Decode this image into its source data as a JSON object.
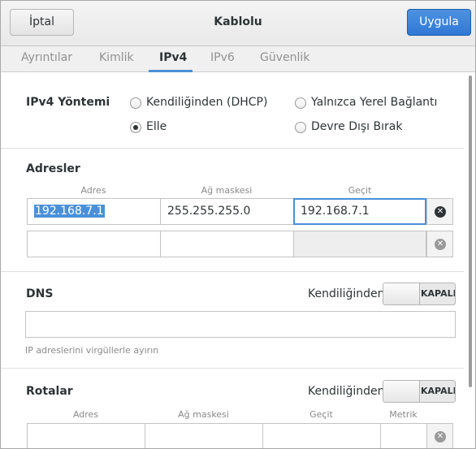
{
  "header": {
    "cancel_label": "İptal",
    "title": "Kablolu",
    "apply_label": "Uygula"
  },
  "tabs": [
    {
      "label": "Ayrıntılar",
      "active": false
    },
    {
      "label": "Kimlik",
      "active": false
    },
    {
      "label": "IPv4",
      "active": true
    },
    {
      "label": "IPv6",
      "active": false
    },
    {
      "label": "Güvenlik",
      "active": false
    }
  ],
  "ipv4_method": {
    "label": "IPv4 Yöntemi",
    "options": [
      {
        "label": "Kendiliğinden (DHCP)",
        "selected": false
      },
      {
        "label": "Yalnızca Yerel Bağlantı",
        "selected": false
      },
      {
        "label": "Elle",
        "selected": true
      },
      {
        "label": "Devre Dışı Bırak",
        "selected": false
      }
    ]
  },
  "addresses": {
    "label": "Adresler",
    "columns": [
      "Adres",
      "Ağ maskesi",
      "Geçit"
    ],
    "rows": [
      {
        "address": "192.168.7.1",
        "netmask": "255.255.255.0",
        "gateway": "192.168.7.1"
      },
      {
        "address": "",
        "netmask": "",
        "gateway": ""
      }
    ]
  },
  "dns": {
    "label": "DNS",
    "auto_label": "Kendiliğinden",
    "switch_state": "KAPALI",
    "value": "",
    "hint": "IP adreslerini virgüllerle ayırın"
  },
  "routes": {
    "label": "Rotalar",
    "auto_label": "Kendiliğinden",
    "switch_state": "KAPALI",
    "columns": [
      "Adres",
      "Ağ maskesi",
      "Geçit",
      "Metrik"
    ]
  },
  "colors": {
    "accent": "#4a90d9",
    "apply_button": "#3078d6",
    "text": "#2e3436",
    "muted": "#8a8a8a"
  }
}
